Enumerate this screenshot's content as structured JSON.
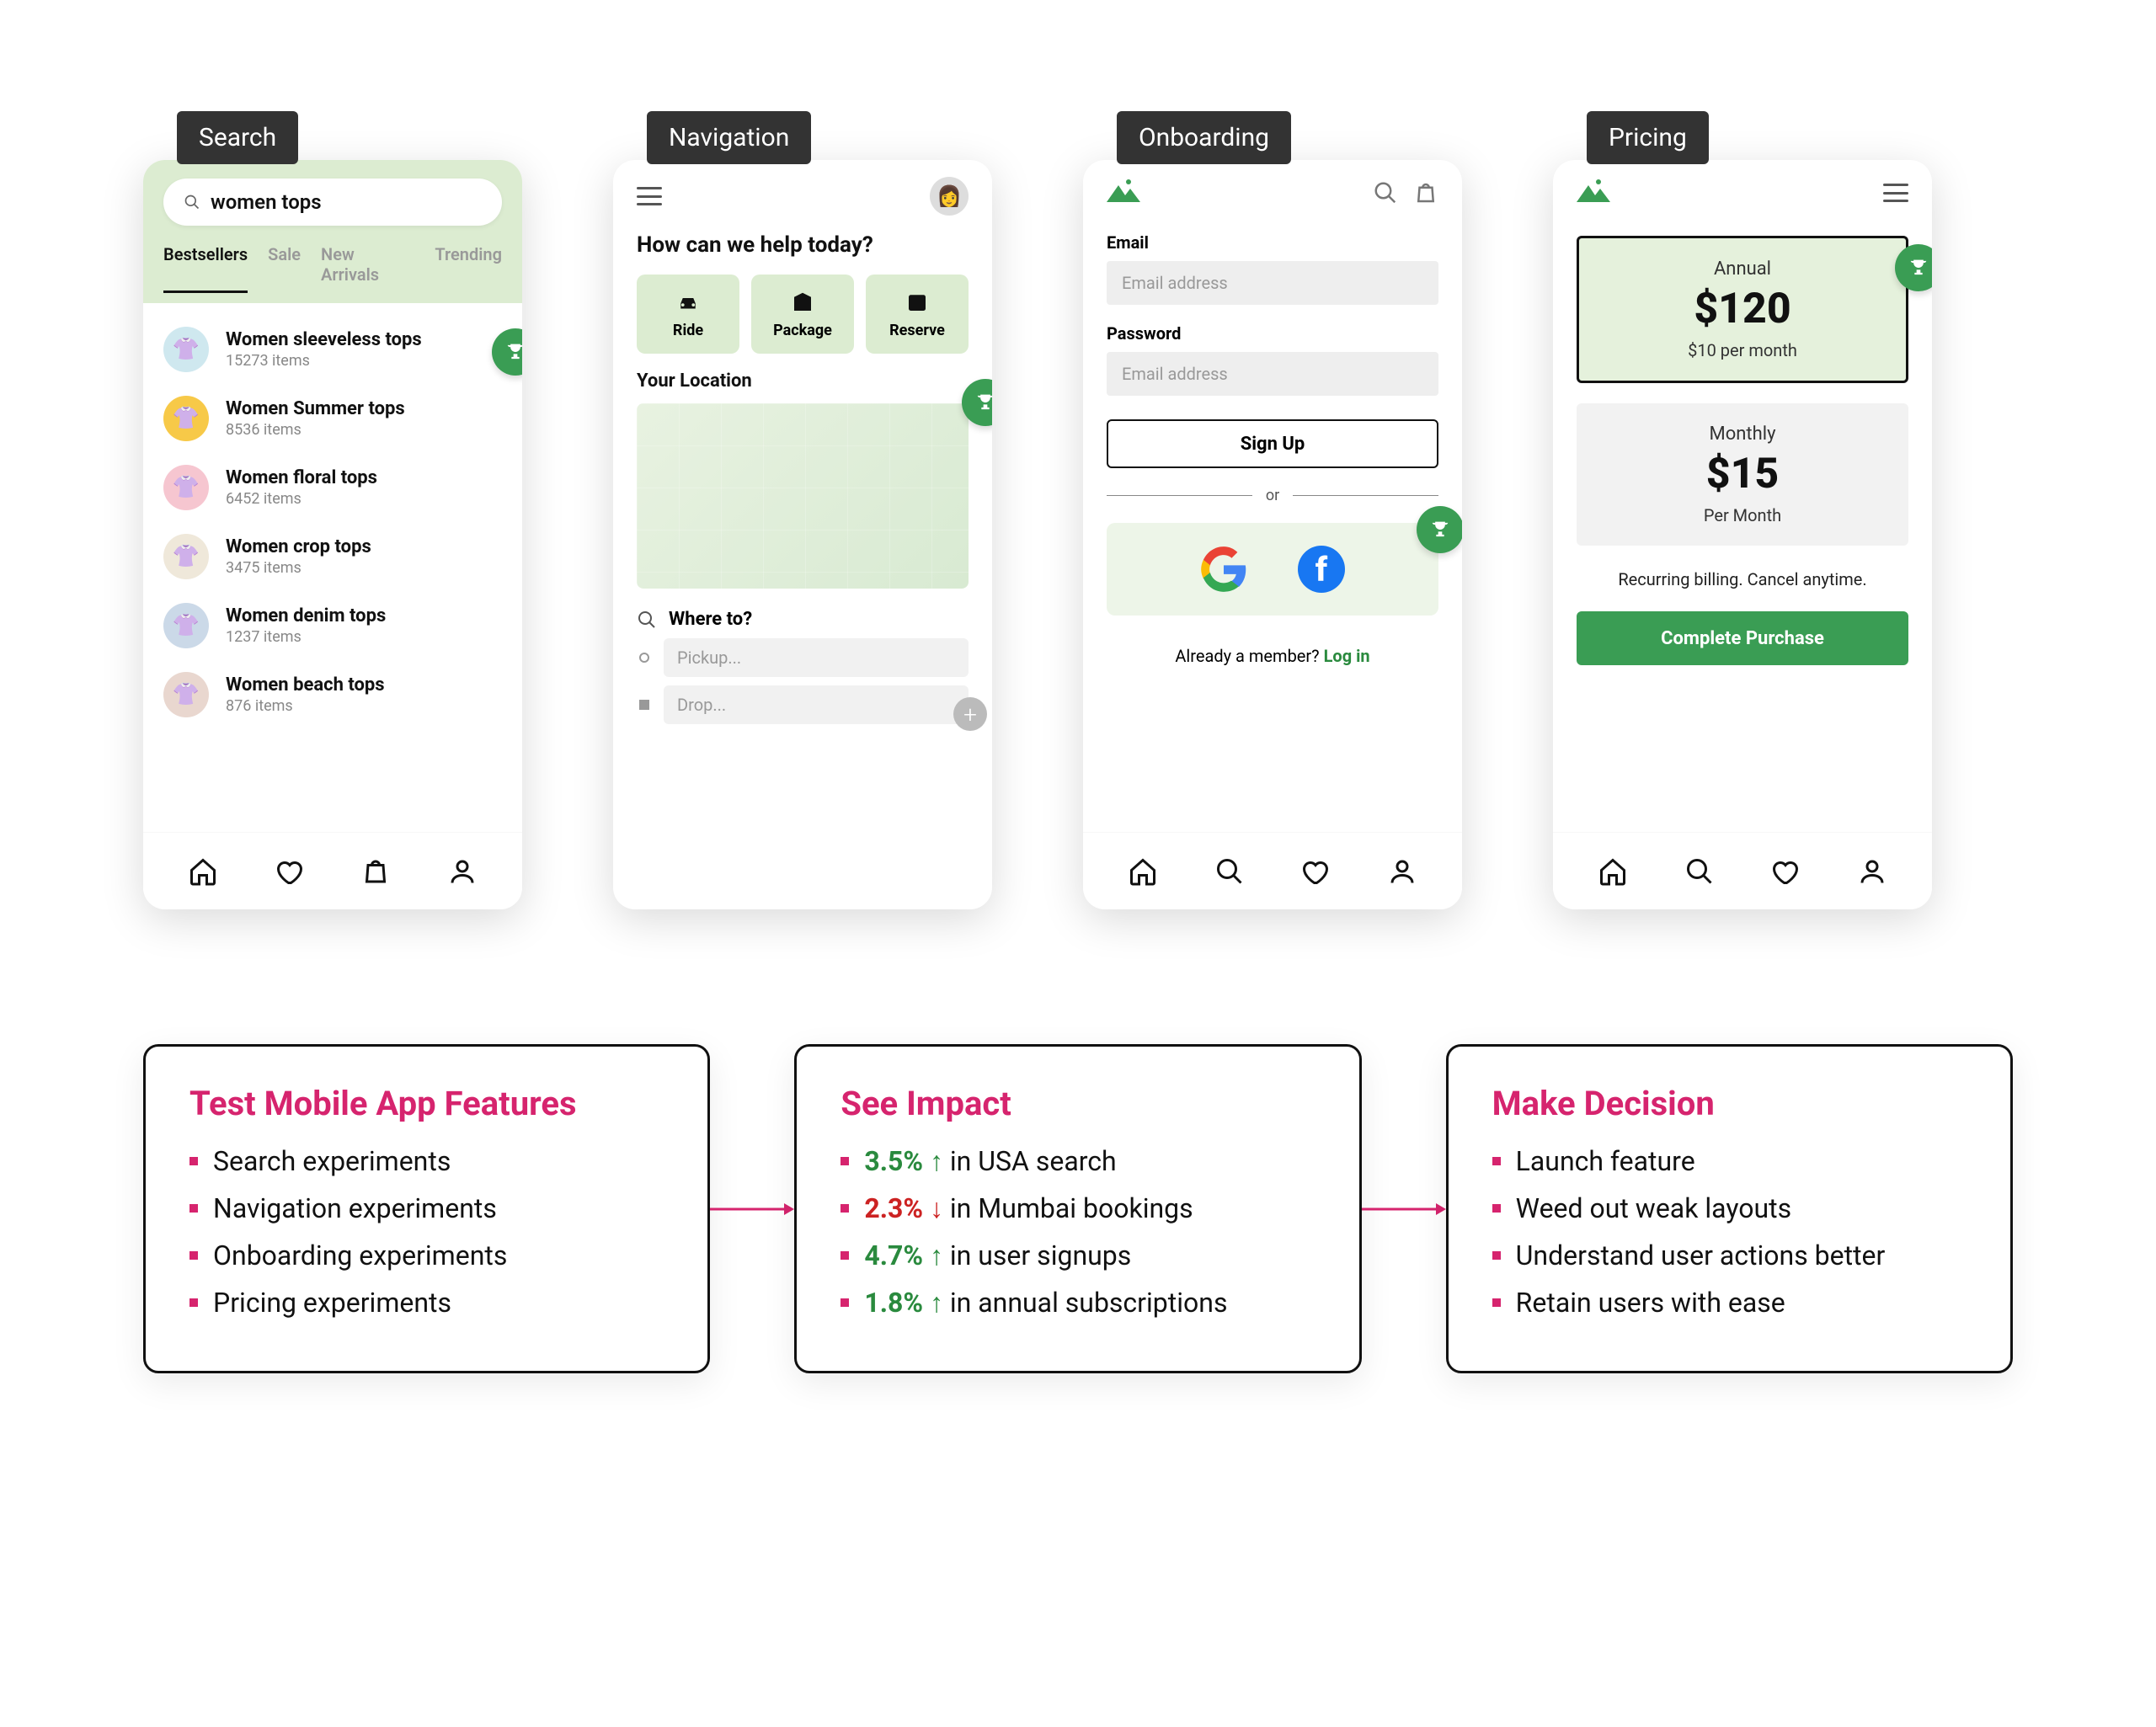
{
  "labels": {
    "search": "Search",
    "navigation": "Navigation",
    "onboarding": "Onboarding",
    "pricing": "Pricing"
  },
  "search_screen": {
    "query": "women tops",
    "tabs": [
      "Bestsellers",
      "Sale",
      "New Arrivals",
      "Trending"
    ],
    "results": [
      {
        "title": "Women sleeveless tops",
        "sub": "15273 items",
        "bg": "#cfe8ef"
      },
      {
        "title": "Women Summer tops",
        "sub": "8536 items",
        "bg": "#f7c948"
      },
      {
        "title": "Women floral tops",
        "sub": "6452 items",
        "bg": "#f6c6d0"
      },
      {
        "title": "Women crop tops",
        "sub": "3475 items",
        "bg": "#efe8da"
      },
      {
        "title": "Women denim tops",
        "sub": "1237 items",
        "bg": "#cbd9e8"
      },
      {
        "title": "Women beach tops",
        "sub": "876 items",
        "bg": "#e9d7cf"
      }
    ]
  },
  "nav_screen": {
    "heading": "How can we help today?",
    "actions": {
      "ride": "Ride",
      "package": "Package",
      "reserve": "Reserve"
    },
    "location_label": "Your Location",
    "where_label": "Where to?",
    "pickup_placeholder": "Pickup...",
    "drop_placeholder": "Drop..."
  },
  "onboard_screen": {
    "email_label": "Email",
    "email_placeholder": "Email address",
    "password_label": "Password",
    "password_placeholder": "Email address",
    "signup": "Sign Up",
    "or": "or",
    "member_text": "Already a member? ",
    "login": "Log in"
  },
  "pricing_screen": {
    "annual": {
      "caption": "Annual",
      "price": "$120",
      "sub": "$10 per month"
    },
    "monthly": {
      "caption": "Monthly",
      "price": "$15",
      "sub": "Per Month"
    },
    "note": "Recurring billing. Cancel anytime.",
    "cta": "Complete Purchase"
  },
  "steps": {
    "a": {
      "title": "Test Mobile App Features",
      "items": [
        "Search experiments",
        "Navigation experiments",
        "Onboarding experiments",
        "Pricing experiments"
      ]
    },
    "b": {
      "title": "See Impact",
      "items": [
        {
          "pct": "3.5%",
          "dir": "up",
          "tail": " in USA search"
        },
        {
          "pct": "2.3%",
          "dir": "down",
          "tail": " in Mumbai bookings"
        },
        {
          "pct": "4.7%",
          "dir": "up",
          "tail": " in user signups"
        },
        {
          "pct": "1.8%",
          "dir": "up",
          "tail": " in annual subscriptions"
        }
      ]
    },
    "c": {
      "title": "Make Decision",
      "items": [
        "Launch feature",
        "Weed out weak layouts",
        "Understand user actions better",
        "Retain users with ease"
      ]
    }
  }
}
